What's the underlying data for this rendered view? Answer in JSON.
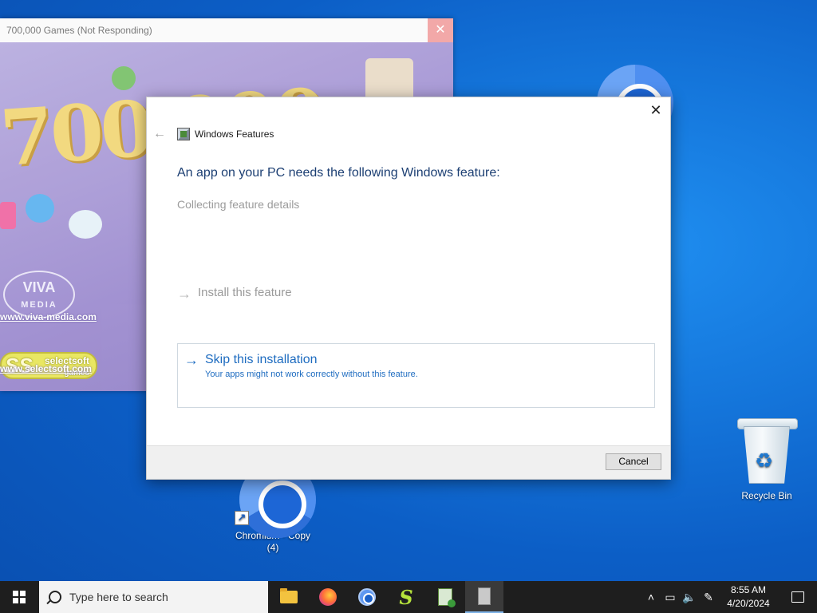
{
  "game_window": {
    "title": "700,000 Games (Not Responding)",
    "art_title": "700,000",
    "viva_brand": "VIVA",
    "viva_sub": "MEDIA",
    "link_viva": "www.viva-media.com",
    "selectsoft_brand": "selectsoft",
    "selectsoft_sub": "games",
    "link_selectsoft": "www.selectsoft.com",
    "close_glyph": "✕"
  },
  "dialog": {
    "title": "Windows Features",
    "heading": "An app on your PC needs the following Windows feature:",
    "status": "Collecting feature details",
    "install_option": "Install this feature",
    "skip_option": "Skip this installation",
    "skip_description": "Your apps might not work correctly without this feature.",
    "cancel_label": "Cancel",
    "close_glyph": "✕",
    "back_glyph": "←",
    "arrow_glyph": "→"
  },
  "desktop": {
    "chromium_copy_label": "Chromium - Copy (4)",
    "recycle_bin_label": "Recycle Bin"
  },
  "taskbar": {
    "search_placeholder": "Type here to search",
    "apps": [
      "file-explorer",
      "firefox",
      "chromium",
      "s-app",
      "calc-app",
      "game-app"
    ],
    "time": "8:55 AM",
    "date": "4/20/2024"
  },
  "colors": {
    "desktop_blue": "#1577dc",
    "link_blue": "#1e6cc0",
    "heading_navy": "#1c3f73"
  }
}
